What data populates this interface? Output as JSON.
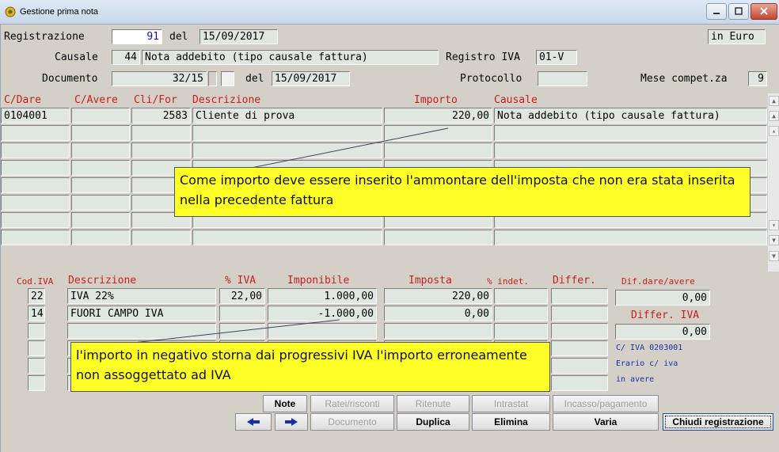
{
  "window": {
    "title": "Gestione prima nota"
  },
  "header": {
    "registrazione_label": "Registrazione",
    "registrazione_value": "91",
    "del_label": "del",
    "registrazione_date": "15/09/2017",
    "currency": "in Euro",
    "causale_label": "Causale",
    "causale_code": "44",
    "causale_desc": "Nota addebito (tipo causale fattura)",
    "registro_iva_label": "Registro IVA",
    "registro_iva_value": "01-V",
    "documento_label": "Documento",
    "documento_value": "32/15",
    "documento_del_label": "del",
    "documento_date": "15/09/2017",
    "protocollo_label": "Protocollo",
    "protocollo_value": "",
    "mese_label": "Mese compet.za",
    "mese_value": "9"
  },
  "movements": {
    "columns": [
      "C/Dare",
      "C/Avere",
      "Cli/For",
      "Descrizione",
      "Importo",
      "Causale"
    ],
    "rows": [
      [
        "0104001",
        "",
        "2583",
        "Cliente di prova",
        "220,00",
        "Nota addebito (tipo causale fattura)"
      ],
      [
        "",
        "",
        "",
        "",
        "",
        ""
      ],
      [
        "",
        "",
        "",
        "",
        "",
        ""
      ],
      [
        "",
        "",
        "",
        "",
        "",
        ""
      ],
      [
        "",
        "",
        "",
        "",
        "",
        ""
      ],
      [
        "",
        "",
        "",
        "",
        "",
        ""
      ],
      [
        "",
        "",
        "",
        "",
        "",
        ""
      ],
      [
        "",
        "",
        "",
        "",
        "",
        ""
      ]
    ]
  },
  "iva": {
    "columns": [
      "Cod.IVA",
      "Descrizione",
      "% IVA",
      "Imponibile",
      "Imposta",
      "% indet.",
      "Differ."
    ],
    "rows": [
      [
        "22",
        "IVA 22%",
        "22,00",
        "1.000,00",
        "220,00",
        "",
        ""
      ],
      [
        "14",
        "FUORI CAMPO IVA",
        "",
        "-1.000,00",
        "0,00",
        "",
        ""
      ],
      [
        "",
        "",
        "",
        "",
        "",
        "",
        ""
      ],
      [
        "",
        "",
        "",
        "",
        "",
        "",
        ""
      ],
      [
        "",
        "",
        "",
        "",
        "",
        "",
        ""
      ],
      [
        "",
        "",
        "",
        "",
        "",
        "",
        ""
      ]
    ]
  },
  "summary": {
    "dif_label": "Dif.dare/avere",
    "dif_value": "0,00",
    "differ_iva_label": "Differ. IVA",
    "differ_iva_value": "0,00",
    "conto_iva": "C/ IVA 0203001",
    "erario": "Erario c/ iva",
    "in_avere": "in avere"
  },
  "callouts": {
    "importo": "Come importo deve essere inserito l'ammontare dell'imposta che non era stata inserita nella precedente fattura",
    "negativo": "l'importo in negativo storna dai progressivi IVA l'importo erroneamente non assoggettato ad IVA"
  },
  "buttons": {
    "note": "Note",
    "ratei": "Ratei/risconti",
    "ritenute": "Ritenute",
    "intrastat": "Intrastat",
    "incasso": "Incasso/pagamento",
    "documento": "Documento",
    "duplica": "Duplica",
    "elimina": "Elimina",
    "varia": "Varia",
    "chiudi": "Chiudi registrazione"
  }
}
